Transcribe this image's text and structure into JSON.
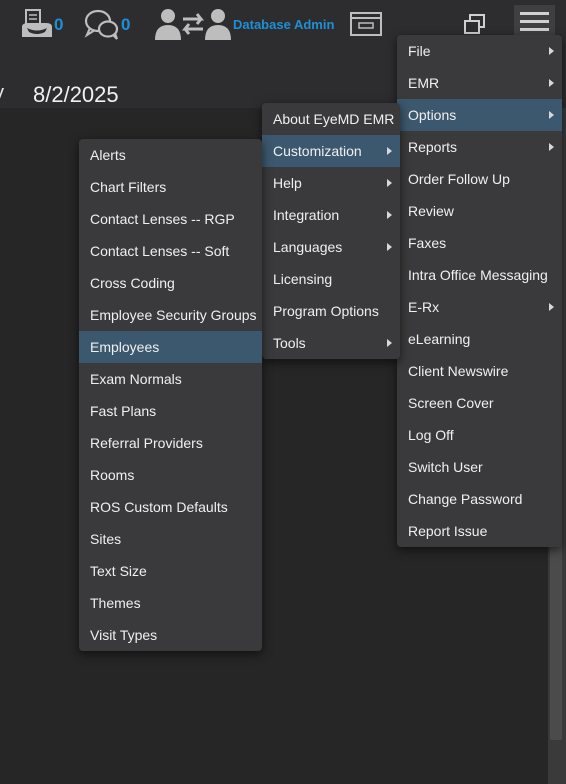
{
  "header": {
    "fax_count": "0",
    "message_count": "0",
    "user_label": "Database Admin"
  },
  "page": {
    "date_partial": "y",
    "date": "8/2/2025"
  },
  "main_menu": [
    {
      "label": "File",
      "submenu": true
    },
    {
      "label": "EMR",
      "submenu": true
    },
    {
      "label": "Options",
      "submenu": true,
      "highlighted": true
    },
    {
      "label": "Reports",
      "submenu": true
    },
    {
      "label": "Order Follow Up",
      "submenu": false
    },
    {
      "label": "Review",
      "submenu": false
    },
    {
      "label": "Faxes",
      "submenu": false
    },
    {
      "label": "Intra Office Messaging",
      "submenu": false
    },
    {
      "label": "E-Rx",
      "submenu": true
    },
    {
      "label": "eLearning",
      "submenu": false
    },
    {
      "label": "Client Newswire",
      "submenu": false
    },
    {
      "label": "Screen Cover",
      "submenu": false
    },
    {
      "label": "Log Off",
      "submenu": false
    },
    {
      "label": "Switch User",
      "submenu": false
    },
    {
      "label": "Change Password",
      "submenu": false
    },
    {
      "label": "Report Issue",
      "submenu": false
    }
  ],
  "options_menu": [
    {
      "label": "About EyeMD EMR",
      "submenu": false
    },
    {
      "label": "Customization",
      "submenu": true,
      "highlighted": true
    },
    {
      "label": "Help",
      "submenu": true
    },
    {
      "label": "Integration",
      "submenu": true
    },
    {
      "label": "Languages",
      "submenu": true
    },
    {
      "label": "Licensing",
      "submenu": false
    },
    {
      "label": "Program Options",
      "submenu": false
    },
    {
      "label": "Tools",
      "submenu": true
    }
  ],
  "customization_menu": [
    {
      "label": "Alerts"
    },
    {
      "label": "Chart Filters"
    },
    {
      "label": "Contact Lenses -- RGP"
    },
    {
      "label": "Contact Lenses -- Soft"
    },
    {
      "label": "Cross Coding"
    },
    {
      "label": "Employee Security Groups"
    },
    {
      "label": "Employees",
      "highlighted": true
    },
    {
      "label": "Exam Normals"
    },
    {
      "label": "Fast Plans"
    },
    {
      "label": "Referral Providers"
    },
    {
      "label": "Rooms"
    },
    {
      "label": "ROS Custom Defaults"
    },
    {
      "label": "Sites"
    },
    {
      "label": "Text Size"
    },
    {
      "label": "Themes"
    },
    {
      "label": "Visit Types"
    }
  ],
  "icons": {
    "fax": "fax-icon",
    "messages": "chat-bubbles-icon",
    "switch_user": "switch-user-icon",
    "screen_cover": "screen-cover-icon",
    "minimize": "minimize-icon",
    "restore": "restore-icon",
    "menu": "hamburger-menu-icon"
  },
  "colors": {
    "accent": "#1e8fd6",
    "highlight": "#3c586e",
    "menu_bg": "#3a3a3c"
  }
}
